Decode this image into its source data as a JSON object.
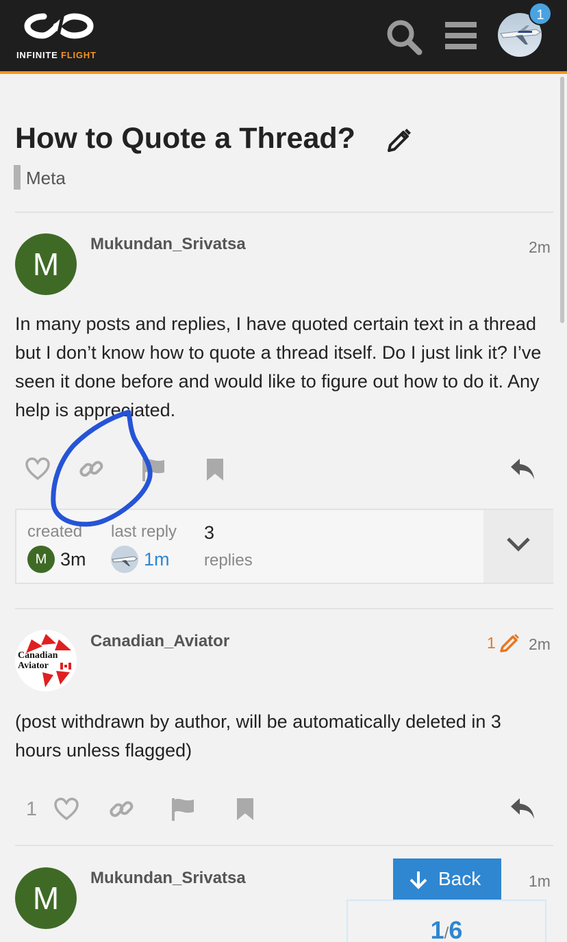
{
  "header": {
    "logo_word1": "INFINITE",
    "logo_word2": "FLIGHT",
    "notification_count": "1",
    "accent_color": "#f7941d",
    "icons": [
      "search-icon",
      "hamburger-menu-icon",
      "user-avatar"
    ]
  },
  "topic": {
    "title": "How to Quote a Thread?",
    "category": "Meta"
  },
  "posts": [
    {
      "author": "Mukundan_Srivatsa",
      "avatar_letter": "M",
      "age": "2m",
      "body": "In many posts and replies, I have quoted certain text in a thread but I don’t know how to quote a thread itself. Do I just link it? I’ve seen it done before and would like to figure out how to do it. Any help is appreciated."
    },
    {
      "author": "Canadian_Aviator",
      "avatar_text_line1": "Canadian",
      "avatar_text_line2": "Aviator",
      "edit_count": "1",
      "age": "2m",
      "body": "(post withdrawn by author, will be automatically deleted in 3 hours unless flagged)",
      "like_count": "1"
    },
    {
      "author": "Mukundan_Srivatsa",
      "avatar_letter": "M",
      "age": "1m"
    }
  ],
  "topic_map": {
    "created_label": "created",
    "created_avatar_letter": "M",
    "created_value": "3m",
    "last_reply_label": "last reply",
    "last_reply_value": "1m",
    "replies_count": "3",
    "replies_label": "replies"
  },
  "nav": {
    "back_label": "Back",
    "progress_current": "1",
    "progress_separator": "/",
    "progress_total": "6"
  }
}
